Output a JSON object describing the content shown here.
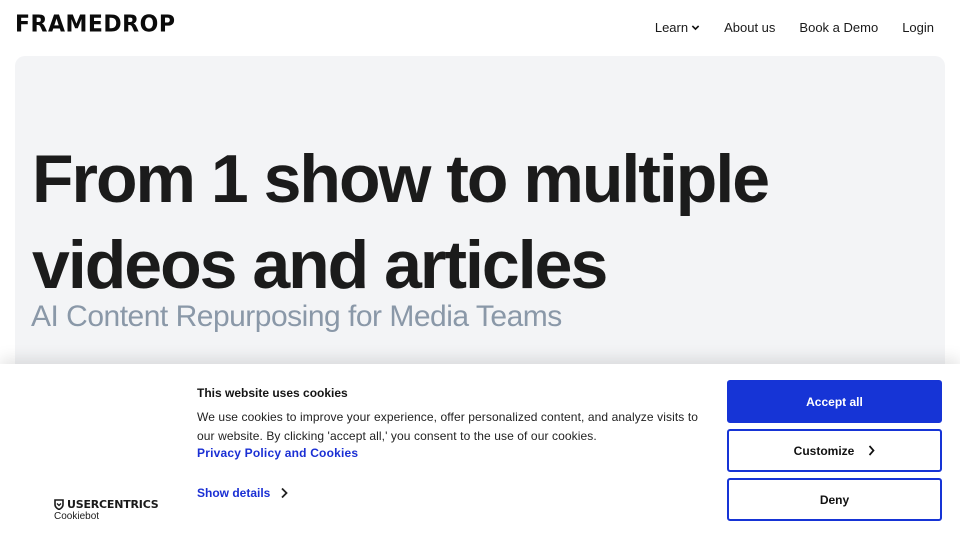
{
  "header": {
    "logo_text": "FRAMEDROP",
    "nav": {
      "learn": "Learn",
      "about": "About us",
      "demo": "Book a Demo",
      "login": "Login"
    }
  },
  "hero": {
    "title_line1": "From 1 show to multiple",
    "title_line2": "videos and articles",
    "subtitle": "AI Content Repurposing for Media Teams"
  },
  "cookie_banner": {
    "title": "This website uses cookies",
    "body": "We use cookies to improve your experience, offer personalized content, and analyze visits to our website. By clicking 'accept all,' you consent to the use of our cookies.",
    "privacy_link": "Privacy Policy and Cookies",
    "show_details": "Show details",
    "accept_all": "Accept all",
    "customize": "Customize",
    "deny": "Deny",
    "brand_top": "USERCENTRICS",
    "brand_bottom": "Cookiebot"
  },
  "colors": {
    "accent": "#1634d6",
    "hero_bg": "#f3f4f6",
    "subtitle": "#8a98a8"
  },
  "icons": [
    "chevron-down-icon",
    "chevron-right-icon",
    "shield-icon"
  ]
}
